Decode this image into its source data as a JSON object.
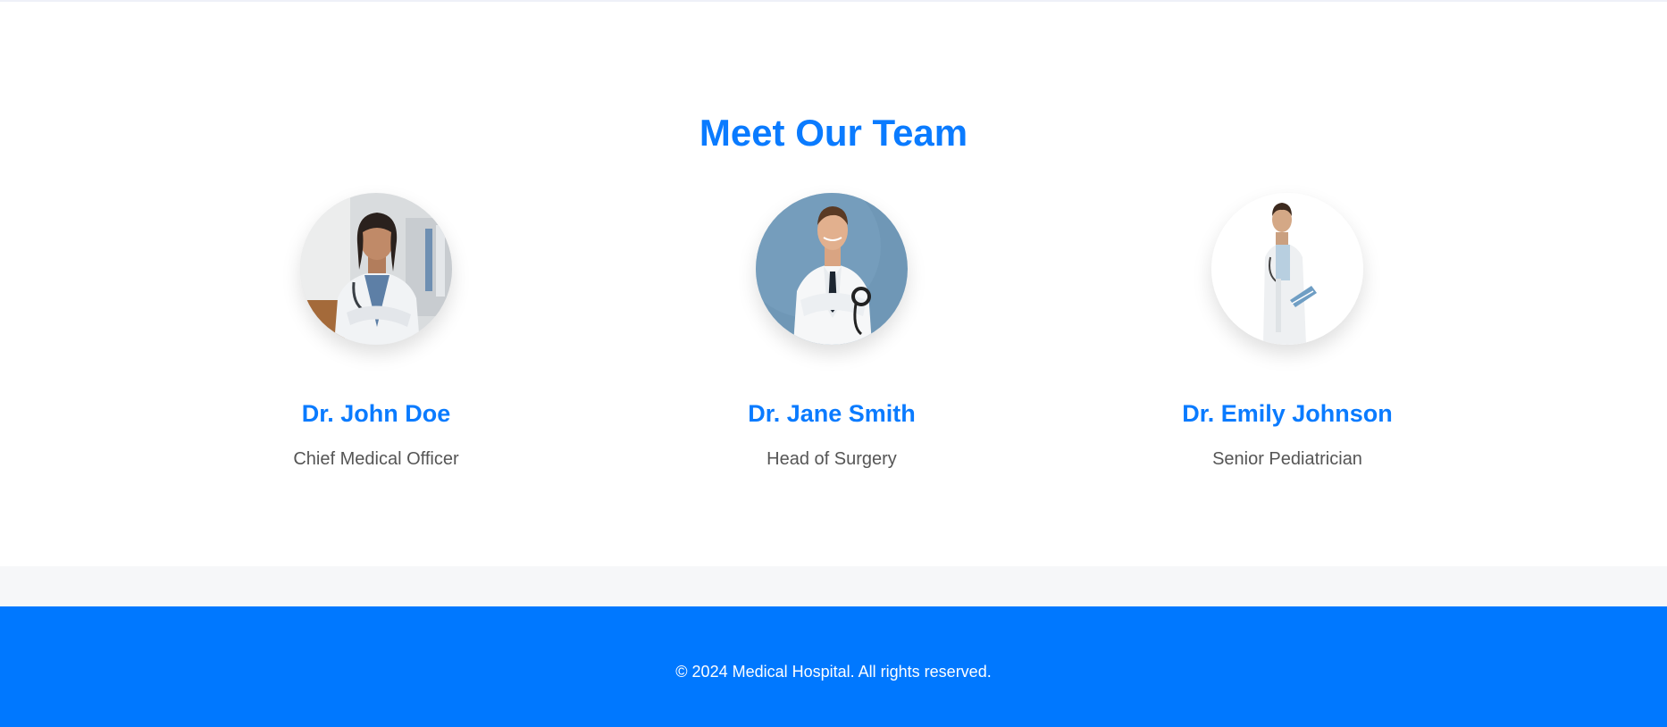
{
  "team": {
    "title": "Meet Our Team",
    "members": [
      {
        "name": "Dr. John Doe",
        "role": "Chief Medical Officer",
        "photo": "doctor-portrait-icon"
      },
      {
        "name": "Dr. Jane Smith",
        "role": "Head of Surgery",
        "photo": "doctor-portrait-icon"
      },
      {
        "name": "Dr. Emily Johnson",
        "role": "Senior Pediatrician",
        "photo": "doctor-portrait-icon"
      }
    ]
  },
  "footer": {
    "copyright": "© 2024 Medical Hospital. All rights reserved."
  },
  "colors": {
    "accent": "#0a7bff",
    "footer_background": "#0078ff",
    "role_text": "#555555"
  }
}
